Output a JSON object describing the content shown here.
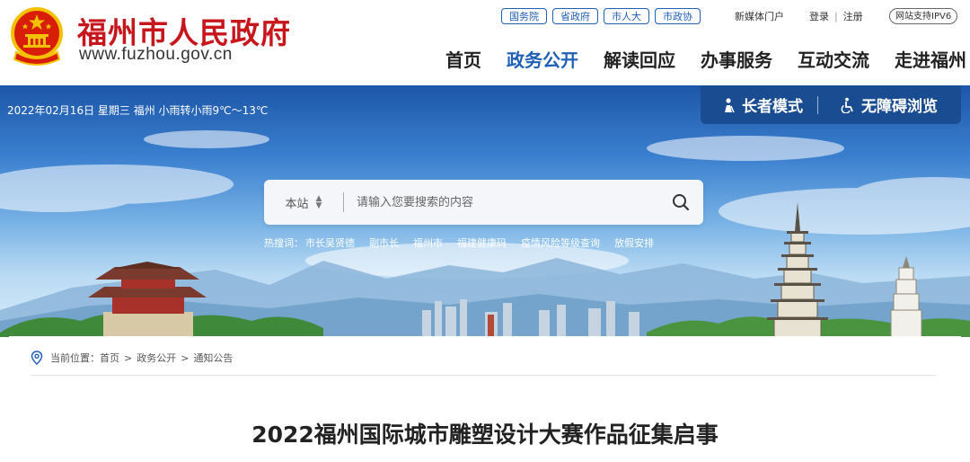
{
  "header": {
    "site_name": "福州市人民政府",
    "site_url": "www.fuzhou.gov.cn",
    "gov_links": [
      "国务院",
      "省政府",
      "市人大",
      "市政协"
    ],
    "utils": {
      "media": "新媒体门户",
      "login": "登录",
      "separator": "|",
      "register": "注册"
    },
    "ipv6": "网站支持IPV6",
    "nav": [
      {
        "label": "首页",
        "active": false
      },
      {
        "label": "政务公开",
        "active": true
      },
      {
        "label": "解读回应",
        "active": false
      },
      {
        "label": "办事服务",
        "active": false
      },
      {
        "label": "互动交流",
        "active": false
      },
      {
        "label": "走进福州",
        "active": false
      }
    ]
  },
  "banner": {
    "date_weather": "2022年02月16日 星期三 福州 小雨转小雨9℃～13℃",
    "elder_mode": "长者模式",
    "accessible": "无障碍浏览",
    "search": {
      "scope": "本站",
      "placeholder": "请输入您要搜索的内容"
    },
    "hot_label": "热搜词：",
    "hot_words": [
      "市长吴贤德",
      "副市长",
      "福州市",
      "福建健康码",
      "疫情风险等级查询",
      "放假安排"
    ]
  },
  "content": {
    "breadcrumb_label": "当前位置：",
    "breadcrumb": [
      "首页",
      "政务公开",
      "通知公告"
    ],
    "breadcrumb_sep": ">",
    "title": "2022福州国际城市雕塑设计大赛作品征集启事"
  },
  "colors": {
    "brand_red": "#c8161d",
    "accent_blue": "#1f5fb5",
    "mode_bar": "#1a4c91"
  },
  "icons": {
    "emblem": "national-emblem-icon",
    "elder": "elder-person-icon",
    "accessible": "wheelchair-icon",
    "search": "search-icon",
    "location": "location-pin-icon"
  }
}
